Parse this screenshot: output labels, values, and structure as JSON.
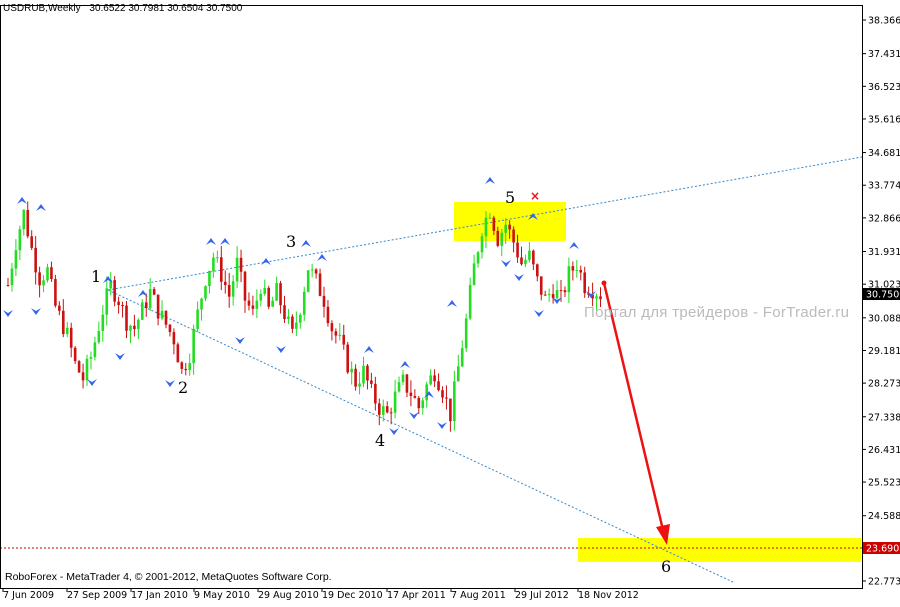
{
  "header": {
    "symbol_timeframe": "USDRUB,Weekly",
    "ohlc": "30.6522 30.7981 30.6504 30.7500"
  },
  "footer": {
    "copyright": "RoboForex - MetaTrader 4, © 2001-2012, MetaQuotes Software Corp."
  },
  "watermark": "Портал для трейдеров - ForTrader.ru",
  "colors": {
    "bull": "#22dd22",
    "bear": "#cc1111",
    "channel": "#3388cc",
    "zone": "#ffff00",
    "arrow": "#ee1111",
    "fractal": "#3366ee",
    "price_label": "#cc0000"
  },
  "chart_data": {
    "type": "candlestick",
    "title": "USDRUB,Weekly",
    "y_ticks": [
      "38.3665",
      "37.4310",
      "36.5235",
      "35.6160",
      "34.6815",
      "33.7740",
      "32.8665",
      "31.9315",
      "31.0235",
      "30.0885",
      "29.1810",
      "28.2735",
      "27.3385",
      "26.4310",
      "25.5235",
      "24.5885",
      "23.6810",
      "22.7735"
    ],
    "ylim": [
      22.7735,
      38.3665
    ],
    "x_ticks": [
      "7 Jun 2009",
      "27 Sep 2009",
      "17 Jan 2010",
      "9 May 2010",
      "29 Aug 2010",
      "19 Dec 2010",
      "17 Apr 2011",
      "7 Aug 2011",
      "29 Jul 2012",
      "18 Nov 2012"
    ],
    "current_price": "30.7500",
    "target_price": "23.6903",
    "wave_labels": [
      "1",
      "2",
      "3",
      "4",
      "5",
      "6"
    ],
    "price_path": [
      [
        0,
        31.0
      ],
      [
        2,
        32.2
      ],
      [
        4,
        33.0
      ],
      [
        6,
        32.0
      ],
      [
        8,
        31.2
      ],
      [
        10,
        31.4
      ],
      [
        12,
        30.4
      ],
      [
        15,
        29.6
      ],
      [
        17,
        28.8
      ],
      [
        19,
        28.4
      ],
      [
        21,
        29.0
      ],
      [
        24,
        30.3
      ],
      [
        26,
        31.0
      ],
      [
        28,
        30.6
      ],
      [
        30,
        30.0
      ],
      [
        32,
        29.8
      ],
      [
        34,
        30.3
      ],
      [
        36,
        30.8
      ],
      [
        38,
        30.3
      ],
      [
        40,
        29.9
      ],
      [
        42,
        29.5
      ],
      [
        44,
        28.6
      ],
      [
        46,
        29.1
      ],
      [
        48,
        30.2
      ],
      [
        50,
        31.2
      ],
      [
        52,
        31.8
      ],
      [
        54,
        31.3
      ],
      [
        56,
        30.7
      ],
      [
        58,
        31.6
      ],
      [
        60,
        30.6
      ],
      [
        62,
        30.2
      ],
      [
        64,
        31.0
      ],
      [
        66,
        30.3
      ],
      [
        68,
        30.8
      ],
      [
        70,
        30.2
      ],
      [
        72,
        29.6
      ],
      [
        74,
        30.4
      ],
      [
        76,
        31.5
      ],
      [
        78,
        31.1
      ],
      [
        80,
        30.6
      ],
      [
        82,
        29.8
      ],
      [
        84,
        29.4
      ],
      [
        86,
        28.8
      ],
      [
        88,
        28.3
      ],
      [
        90,
        28.6
      ],
      [
        92,
        28.0
      ],
      [
        94,
        27.6
      ],
      [
        96,
        27.4
      ],
      [
        98,
        27.9
      ],
      [
        100,
        28.3
      ],
      [
        102,
        28.0
      ],
      [
        104,
        27.6
      ],
      [
        106,
        28.2
      ],
      [
        108,
        28.6
      ],
      [
        110,
        28.1
      ],
      [
        112,
        27.4
      ],
      [
        114,
        28.7
      ],
      [
        116,
        30.0
      ],
      [
        118,
        31.5
      ],
      [
        120,
        32.6
      ],
      [
        122,
        33.1
      ],
      [
        124,
        32.3
      ],
      [
        126,
        32.7
      ],
      [
        128,
        32.2
      ],
      [
        130,
        31.6
      ],
      [
        132,
        31.8
      ],
      [
        134,
        31.1
      ],
      [
        136,
        30.6
      ],
      [
        138,
        30.9
      ],
      [
        140,
        30.6
      ],
      [
        142,
        31.3
      ],
      [
        144,
        31.6
      ],
      [
        146,
        31.0
      ],
      [
        148,
        30.9
      ],
      [
        150,
        30.75
      ]
    ]
  }
}
